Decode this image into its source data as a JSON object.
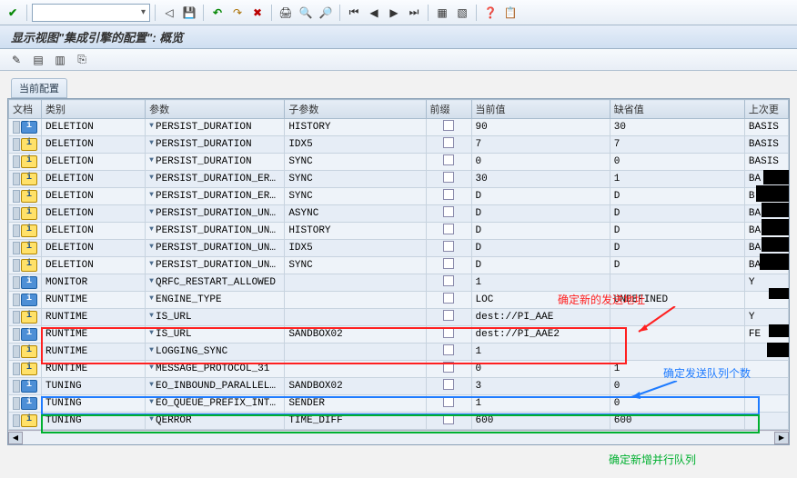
{
  "page_title": "显示视图\"集成引擎的配置\": 概览",
  "section_label": "当前配置",
  "columns": {
    "doc": "文档",
    "category": "类别",
    "param": "参数",
    "subparam": "子参数",
    "prefix": "前缀",
    "current": "当前值",
    "default": "缺省值",
    "last": "上次更"
  },
  "rows": [
    {
      "icon": "blue",
      "cat": "DELETION",
      "param": "PERSIST_DURATION",
      "sub": "HISTORY",
      "cur": "90",
      "def": "30",
      "last": "BASIS"
    },
    {
      "icon": "yellow",
      "cat": "DELETION",
      "param": "PERSIST_DURATION",
      "sub": "IDX5",
      "cur": "7",
      "def": "7",
      "last": "BASIS"
    },
    {
      "icon": "yellow",
      "cat": "DELETION",
      "param": "PERSIST_DURATION",
      "sub": "SYNC",
      "cur": "0",
      "def": "0",
      "last": "BASIS"
    },
    {
      "icon": "yellow",
      "cat": "DELETION",
      "param": "PERSIST_DURATION_ER…",
      "sub": "SYNC",
      "cur": "30",
      "def": "1",
      "last": "BA"
    },
    {
      "icon": "yellow",
      "cat": "DELETION",
      "param": "PERSIST_DURATION_ER…",
      "sub": "SYNC",
      "cur": "D",
      "def": "D",
      "last": "B"
    },
    {
      "icon": "yellow",
      "cat": "DELETION",
      "param": "PERSIST_DURATION_UN…",
      "sub": "ASYNC",
      "cur": "D",
      "def": "D",
      "last": "BA"
    },
    {
      "icon": "yellow",
      "cat": "DELETION",
      "param": "PERSIST_DURATION_UN…",
      "sub": "HISTORY",
      "cur": "D",
      "def": "D",
      "last": "BA"
    },
    {
      "icon": "yellow",
      "cat": "DELETION",
      "param": "PERSIST_DURATION_UN…",
      "sub": "IDX5",
      "cur": "D",
      "def": "D",
      "last": "BA"
    },
    {
      "icon": "yellow",
      "cat": "DELETION",
      "param": "PERSIST_DURATION_UN…",
      "sub": "SYNC",
      "cur": "D",
      "def": "D",
      "last": "BA"
    },
    {
      "icon": "blue",
      "cat": "MONITOR",
      "param": "QRFC_RESTART_ALLOWED",
      "sub": "",
      "cur": "1",
      "def": "",
      "last": "Y"
    },
    {
      "icon": "blue",
      "cat": "RUNTIME",
      "param": "ENGINE_TYPE",
      "sub": "",
      "cur": "LOC",
      "def": "UNDEFINED",
      "last": ""
    },
    {
      "icon": "yellow",
      "cat": "RUNTIME",
      "param": "IS_URL",
      "sub": "",
      "cur": "dest://PI_AAE",
      "def": "",
      "last": "Y"
    },
    {
      "icon": "blue",
      "cat": "RUNTIME",
      "param": "IS_URL",
      "sub": "SANDBOX02",
      "cur": "dest://PI_AAE2",
      "def": "",
      "last": "FE"
    },
    {
      "icon": "yellow",
      "cat": "RUNTIME",
      "param": "LOGGING_SYNC",
      "sub": "",
      "cur": "1",
      "def": "",
      "last": ""
    },
    {
      "icon": "yellow",
      "cat": "RUNTIME",
      "param": "MESSAGE_PROTOCOL_31",
      "sub": "",
      "cur": "0",
      "def": "1",
      "last": ""
    },
    {
      "icon": "blue",
      "cat": "TUNING",
      "param": "EO_INBOUND_PARALLEL…",
      "sub": "SANDBOX02",
      "cur": "3",
      "def": "0",
      "last": ""
    },
    {
      "icon": "blue",
      "cat": "TUNING",
      "param": "EO_QUEUE_PREFIX_INT…",
      "sub": "SENDER",
      "cur": "1",
      "def": "0",
      "last": ""
    },
    {
      "icon": "yellow",
      "cat": "TUNING",
      "param": "QERROR",
      "sub": "TIME_DIFF",
      "cur": "600",
      "def": "600",
      "last": ""
    }
  ],
  "annotations": {
    "red_text": "确定新的发送地址",
    "blue_text": "确定发送队列个数",
    "green_text": "确定新增并行队列"
  }
}
